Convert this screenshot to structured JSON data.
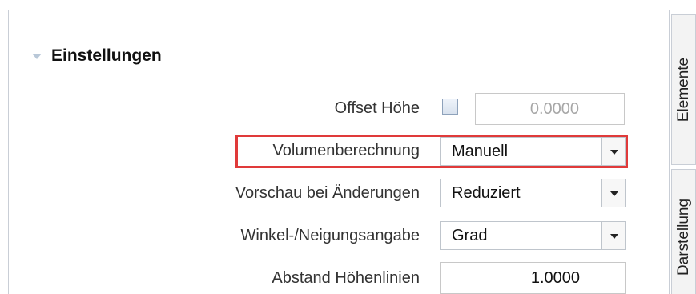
{
  "section": {
    "title": "Einstellungen",
    "chevron_icon": "chevron-down-icon"
  },
  "rows": {
    "offset_hoehe": {
      "label": "Offset Höhe",
      "checked": false,
      "value": "0.0000"
    },
    "volumenberechnung": {
      "label": "Volumenberechnung",
      "selected": "Manuell"
    },
    "vorschau": {
      "label": "Vorschau bei Änderungen",
      "selected": "Reduziert"
    },
    "winkel": {
      "label": "Winkel-/Neigungsangabe",
      "selected": "Grad"
    },
    "abstand": {
      "label": "Abstand Höhenlinien",
      "value": "1.0000"
    }
  },
  "side_tabs": {
    "elemente": "Elemente",
    "darstellung": "Darstellung"
  },
  "colors": {
    "highlight": "#e03a3a",
    "section_line": "#c7d7e8",
    "disabled_text": "#a7a7a7"
  }
}
